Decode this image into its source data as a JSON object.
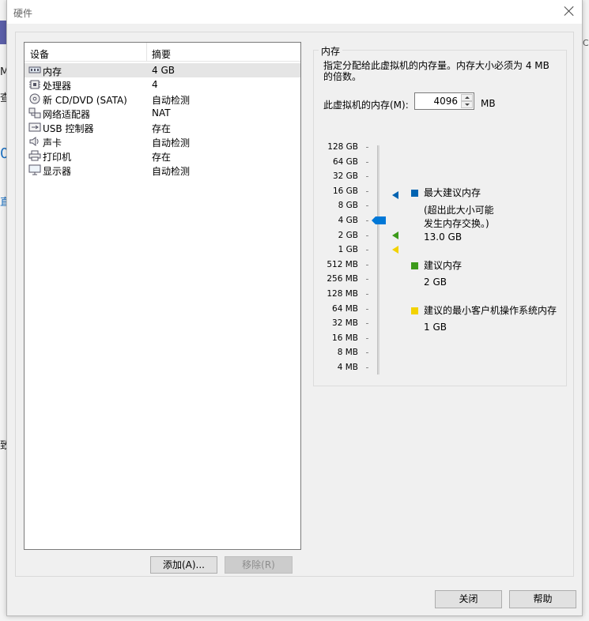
{
  "window": {
    "title": "硬件"
  },
  "background": {
    "frags": [
      "Mi",
      "查",
      "",
      "直",
      "0",
      "致"
    ],
    "right_frag": "C:"
  },
  "device_list": {
    "col_device": "设备",
    "col_summary": "摘要",
    "rows": [
      {
        "icon": "memory-icon",
        "name": "内存",
        "summary": "4 GB",
        "selected": true
      },
      {
        "icon": "processor-icon",
        "name": "处理器",
        "summary": "4"
      },
      {
        "icon": "cd-dvd-icon",
        "name": "新 CD/DVD (SATA)",
        "summary": "自动检测"
      },
      {
        "icon": "network-adapter-icon",
        "name": "网络适配器",
        "summary": "NAT"
      },
      {
        "icon": "usb-controller-icon",
        "name": "USB 控制器",
        "summary": "存在"
      },
      {
        "icon": "sound-card-icon",
        "name": "声卡",
        "summary": "自动检测"
      },
      {
        "icon": "printer-icon",
        "name": "打印机",
        "summary": "存在"
      },
      {
        "icon": "display-icon",
        "name": "显示器",
        "summary": "自动检测"
      }
    ],
    "add_label": "添加(A)...",
    "remove_label": "移除(R)"
  },
  "memory": {
    "group_label": "内存",
    "description": "指定分配给此虚拟机的内存量。内存大小必须为 4 MB 的倍数。",
    "field_label": "此虚拟机的内存(M):",
    "value": "4096",
    "unit": "MB",
    "scale": [
      "128 GB",
      "64 GB",
      "32 GB",
      "16 GB",
      "8 GB",
      "4 GB",
      "2 GB",
      "1 GB",
      "512 MB",
      "256 MB",
      "128 MB",
      "64 MB",
      "32 MB",
      "16 MB",
      "8 MB",
      "4 MB"
    ],
    "slider_level_index": 5,
    "markers": {
      "max_index": 3.3,
      "recommended_index": 6.0,
      "min_os_index": 7.0
    },
    "legend": {
      "max": {
        "title": "最大建议内存",
        "note": "(超出此大小可能\n发生内存交换。)",
        "value": "13.0 GB",
        "color": "#0063b1"
      },
      "recommended": {
        "title": "建议内存",
        "value": "2 GB",
        "color": "#3c9a1a"
      },
      "min_os": {
        "title": "建议的最小客户机操作系统内存",
        "value": "1 GB",
        "color": "#f2d200"
      }
    },
    "slider_color": "#0078d7"
  },
  "footer": {
    "close_label": "关闭",
    "help_label": "帮助"
  }
}
